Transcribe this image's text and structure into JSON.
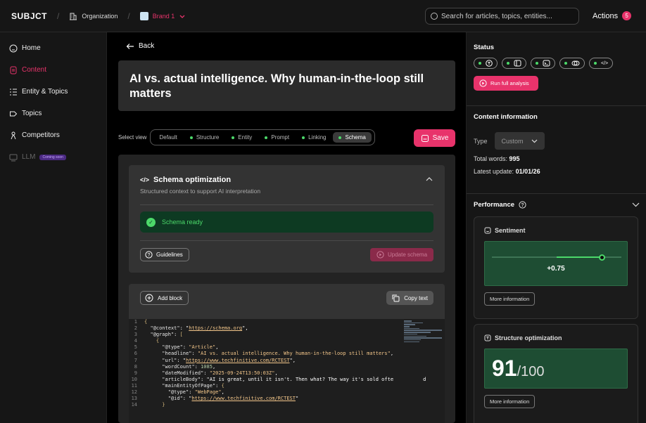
{
  "topbar": {
    "brand": "SUBJCT",
    "org_label": "Organization",
    "brand_label": "Brand 1",
    "search_placeholder": "Search for articles, topics, entities...",
    "actions_label": "Actions",
    "actions_count": "5"
  },
  "sidebar": {
    "items": [
      {
        "label": "Home",
        "icon": "home-icon"
      },
      {
        "label": "Content",
        "icon": "document-icon",
        "active": true
      },
      {
        "label": "Entity & Topics",
        "icon": "list-icon"
      },
      {
        "label": "Topics",
        "icon": "tag-icon"
      },
      {
        "label": "Competitors",
        "icon": "person-icon"
      },
      {
        "label": "LLM",
        "icon": "llm-icon",
        "badge": "Coming soon"
      }
    ]
  },
  "main": {
    "back_label": "Back",
    "title": "AI vs. actual intelligence. Why human-in-the-loop still matters",
    "view_label": "Select view",
    "views": [
      "Default",
      "Structure",
      "Entity",
      "Prompt",
      "Linking",
      "Schema"
    ],
    "active_view": "Schema",
    "save_label": "Save",
    "schema": {
      "title": "Schema optimization",
      "subtitle": "Structured context to support AI interpretation",
      "ready_label": "Schema ready",
      "guidelines_label": "Guidelines",
      "update_label": "Update schema"
    },
    "code": {
      "add_block_label": "Add block",
      "copy_label": "Copy text",
      "lines": [
        "{",
        "  \"@context\": \"https://schema.org\",",
        "  \"@graph\": [",
        "    {",
        "      \"@type\": \"Article\",",
        "      \"headline\": \"AI vs. actual intelligence. Why human-in-the-loop still matters\",",
        "      \"url\": \"https://www.techfinitive.com/RCTEST\",",
        "      \"wordCount\": 1085,",
        "      \"dateModified\": \"2025-09-24T13:50:03Z\",",
        "      \"articleBody\": \"AI is great, until it isn't. Then what? The way it's sold ofte          d",
        "      \"mainEntityOfPage\": {",
        "        \"@type\": \"WebPage\",",
        "        \"@id\": \"https://www.techfinitive.com/RCTEST\"",
        "      }"
      ]
    }
  },
  "right": {
    "status_title": "Status",
    "run_label": "Run full analysis",
    "content_info_title": "Content information",
    "type_label": "Type",
    "type_value": "Custom",
    "total_words_label": "Total words:",
    "total_words": "995",
    "latest_update_label": "Latest update:",
    "latest_update": "01/01/26",
    "performance_title": "Performance",
    "sentiment_title": "Sentiment",
    "sentiment_value": "+0.75",
    "sentiment_level": 0.75,
    "more_info_label": "More information",
    "structure_title": "Structure optimization",
    "structure_score": "91",
    "structure_max": "/100"
  },
  "colors": {
    "accent": "#e8336b",
    "success": "#4cd96a",
    "success_bg": "#0d3a22"
  }
}
